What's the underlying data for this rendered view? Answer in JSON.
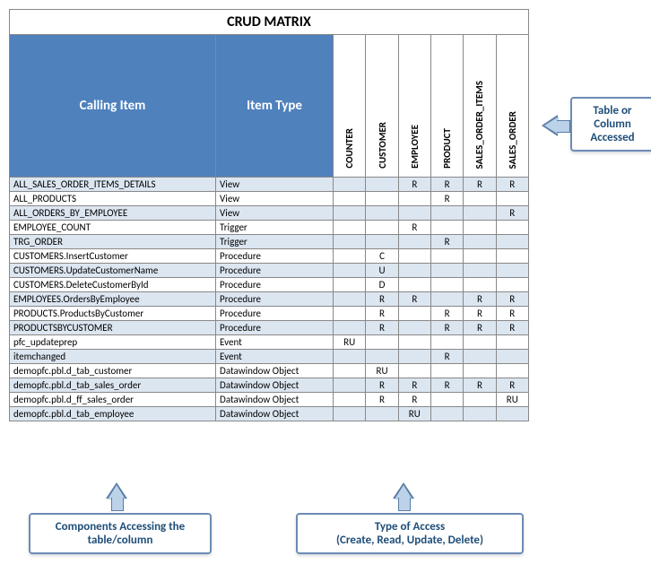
{
  "title": "CRUD MATRIX",
  "headers": {
    "calling": "Calling Item",
    "type": "Item Type"
  },
  "columns": [
    "COUNTER",
    "CUSTOMER",
    "EMPLOYEE",
    "PRODUCT",
    "SALES_ORDER_ITEMS",
    "SALES_ORDER"
  ],
  "rows": [
    {
      "name": "ALL_SALES_ORDER_ITEMS_DETAILS",
      "type": "View",
      "vals": [
        "",
        "",
        "R",
        "R",
        "R",
        "R"
      ]
    },
    {
      "name": "ALL_PRODUCTS",
      "type": "View",
      "vals": [
        "",
        "",
        "",
        "R",
        "",
        ""
      ]
    },
    {
      "name": "ALL_ORDERS_BY_EMPLOYEE",
      "type": "View",
      "vals": [
        "",
        "",
        "",
        "",
        "",
        "R"
      ]
    },
    {
      "name": "EMPLOYEE_COUNT",
      "type": "Trigger",
      "vals": [
        "",
        "",
        "R",
        "",
        "",
        ""
      ]
    },
    {
      "name": "TRG_ORDER",
      "type": "Trigger",
      "vals": [
        "",
        "",
        "",
        "R",
        "",
        ""
      ]
    },
    {
      "name": "CUSTOMERS.InsertCustomer",
      "type": "Procedure",
      "vals": [
        "",
        "C",
        "",
        "",
        "",
        ""
      ]
    },
    {
      "name": "CUSTOMERS.UpdateCustomerName",
      "type": "Procedure",
      "vals": [
        "",
        "U",
        "",
        "",
        "",
        ""
      ]
    },
    {
      "name": "CUSTOMERS.DeleteCustomerById",
      "type": "Procedure",
      "vals": [
        "",
        "D",
        "",
        "",
        "",
        ""
      ]
    },
    {
      "name": "EMPLOYEES.OrdersByEmployee",
      "type": "Procedure",
      "vals": [
        "",
        "R",
        "R",
        "",
        "R",
        "R"
      ]
    },
    {
      "name": "PRODUCTS.ProductsByCustomer",
      "type": "Procedure",
      "vals": [
        "",
        "R",
        "",
        "R",
        "R",
        "R"
      ]
    },
    {
      "name": "PRODUCTSBYCUSTOMER",
      "type": "Procedure",
      "vals": [
        "",
        "R",
        "",
        "R",
        "R",
        "R"
      ]
    },
    {
      "name": "pfc_updateprep",
      "type": "Event",
      "vals": [
        "RU",
        "",
        "",
        "",
        "",
        ""
      ]
    },
    {
      "name": "itemchanged",
      "type": "Event",
      "vals": [
        "",
        "",
        "",
        "R",
        "",
        ""
      ]
    },
    {
      "name": "demopfc.pbl.d_tab_customer",
      "type": "Datawindow Object",
      "vals": [
        "",
        "RU",
        "",
        "",
        "",
        ""
      ]
    },
    {
      "name": "demopfc.pbl.d_tab_sales_order",
      "type": "Datawindow Object",
      "vals": [
        "",
        "R",
        "R",
        "R",
        "R",
        "R"
      ]
    },
    {
      "name": "demopfc.pbl.d_ff_sales_order",
      "type": "Datawindow Object",
      "vals": [
        "",
        "R",
        "R",
        "",
        "",
        "RU"
      ]
    },
    {
      "name": "demopfc.pbl.d_tab_employee",
      "type": "Datawindow Object",
      "vals": [
        "",
        "",
        "RU",
        "",
        "",
        ""
      ]
    }
  ],
  "callouts": {
    "tables": "Table or Column Accessed",
    "components": "Components Accessing the table/column",
    "access": "Type of Access\n(Create, Read, Update, Delete)"
  }
}
